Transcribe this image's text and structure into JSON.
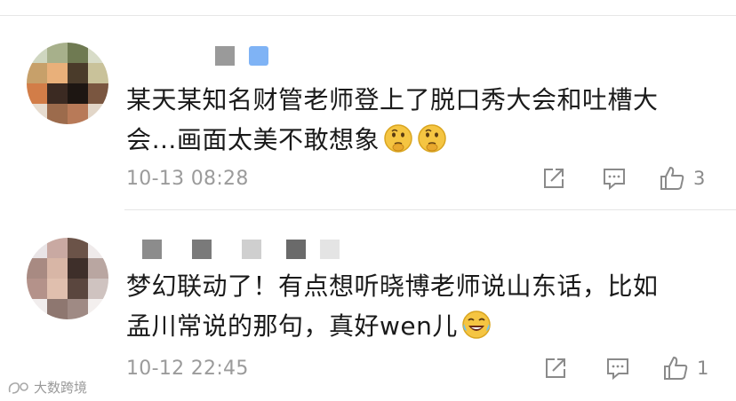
{
  "comments": [
    {
      "text_line1": "某天某知名财管老师登上了脱口秀大会和吐槽大",
      "text_line2": "会…画面太美不敢想象",
      "emojis": [
        "thinking-face-emoji",
        "thinking-face-emoji"
      ],
      "time": "10-13 08:28",
      "likes": "3"
    },
    {
      "text_line1": "梦幻联动了！有点想听晓博老师说山东话，比如",
      "text_line2": "孟川常说的那句，真好wen儿",
      "emojis": [
        "laughing-tears-emoji"
      ],
      "time": "10-12 22:45",
      "likes": "1"
    }
  ],
  "watermark": "大数跨境",
  "icons": {
    "share": "share-icon",
    "comment": "comment-icon",
    "like": "thumbs-up-icon"
  },
  "colors": {
    "text": "#1a1a1a",
    "meta": "#9b9b9b",
    "icon": "#8a8a8a",
    "emoji": "#f5c542"
  }
}
